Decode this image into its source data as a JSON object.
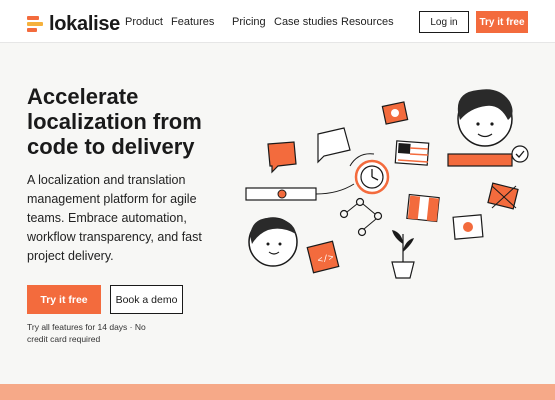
{
  "brand": {
    "name": "lokalise",
    "accent": "#f36b3d"
  },
  "nav": {
    "items": [
      "Product",
      "Features",
      "Pricing",
      "Case studies",
      "Resources"
    ],
    "login_label": "Log in",
    "try_label": "Try it free"
  },
  "hero": {
    "title": "Accelerate localization from code to delivery",
    "description": "A localization and translation management platform for agile teams. Embrace automation, workflow transparency, and fast project delivery.",
    "primary_cta": "Try it free",
    "secondary_cta": "Book a demo",
    "note": "Try all features for 14 days · No credit card required"
  },
  "illustration": {
    "icons": [
      "face-icon",
      "flag-icon",
      "chat-icon",
      "clock-icon",
      "plant-icon",
      "network-icon"
    ]
  }
}
